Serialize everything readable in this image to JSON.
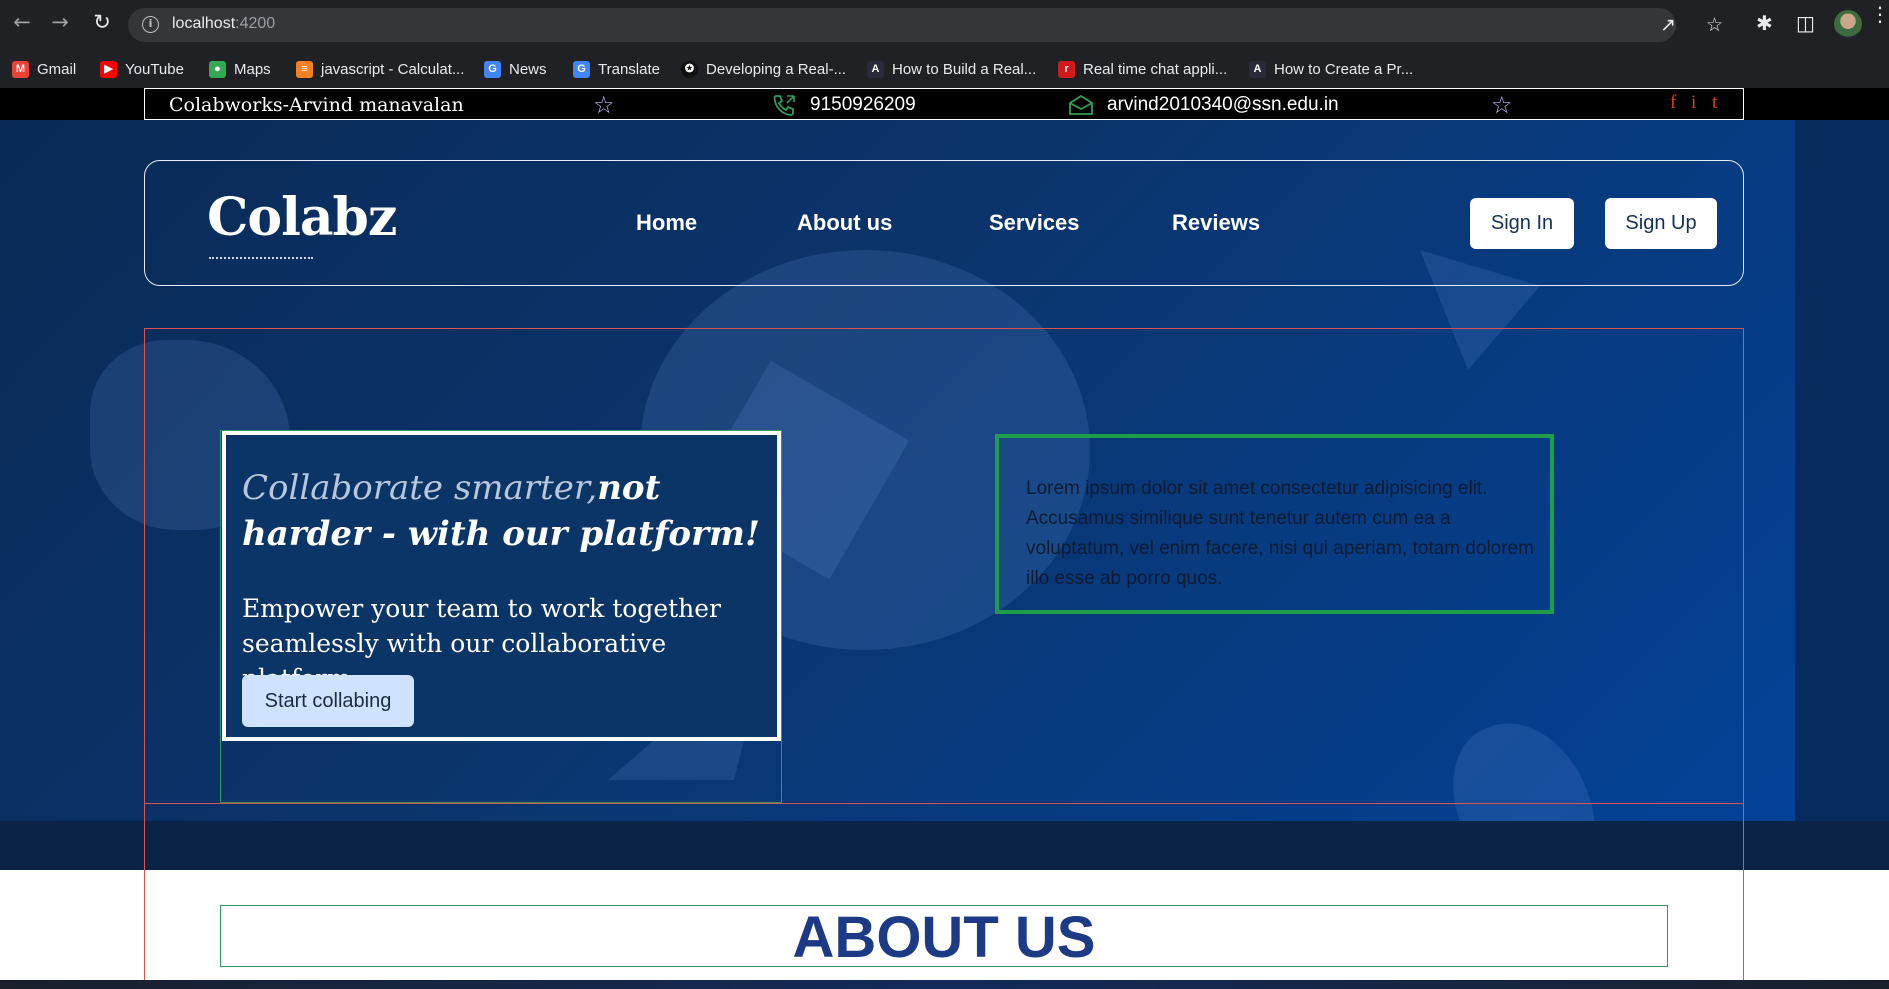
{
  "browser": {
    "url_host": "localhost",
    "url_port": ":4200",
    "bookmarks": [
      {
        "label": "Gmail",
        "icon": "gmail-icon",
        "color": "#ea4335"
      },
      {
        "label": "YouTube",
        "icon": "youtube-icon",
        "color": "#ff0000"
      },
      {
        "label": "Maps",
        "icon": "maps-icon",
        "color": "#34a853"
      },
      {
        "label": "javascript - Calculat...",
        "icon": "stackoverflow-icon",
        "color": "#f48024"
      },
      {
        "label": "News",
        "icon": "news-icon",
        "color": "#4285f4"
      },
      {
        "label": "Translate",
        "icon": "translate-icon",
        "color": "#4285f4"
      },
      {
        "label": "Developing a Real-...",
        "icon": "medium-icon",
        "color": "#111111"
      },
      {
        "label": "How to Build a Real...",
        "icon": "angular-icon",
        "color": "#2a2a3a"
      },
      {
        "label": "Real time chat appli...",
        "icon": "bookmark-red-icon",
        "color": "#d11a1a"
      },
      {
        "label": "How to Create a Pr...",
        "icon": "angular-icon",
        "color": "#2a2a3a"
      }
    ]
  },
  "topbar": {
    "brand": "Colabworks-Arvind manavalan",
    "phone": "9150926209",
    "email": "arvind2010340@ssn.edu.in",
    "social": [
      "f",
      "i",
      "t"
    ],
    "accent": "#d9441c"
  },
  "nav": {
    "logo": "Colabz",
    "links": [
      "Home",
      "About us",
      "Services",
      "Reviews"
    ],
    "sign_in": "Sign In",
    "sign_up": "Sign Up"
  },
  "hero": {
    "headline_light": "Collaborate smarter,",
    "headline_bold": "not harder - with our platform!",
    "subtext": "Empower your team to work together seamlessly with our collaborative platform",
    "cta": "Start collabing",
    "lorem": "Lorem ipsum dolor sit amet consectetur adipisicing elit. Accusamus similique sunt tenetur autem cum ea a voluptatum, vel enim facere, nisi qui aperiam, totam dolorem illo esse ab porro quos."
  },
  "about": {
    "title": "ABOUT US"
  }
}
